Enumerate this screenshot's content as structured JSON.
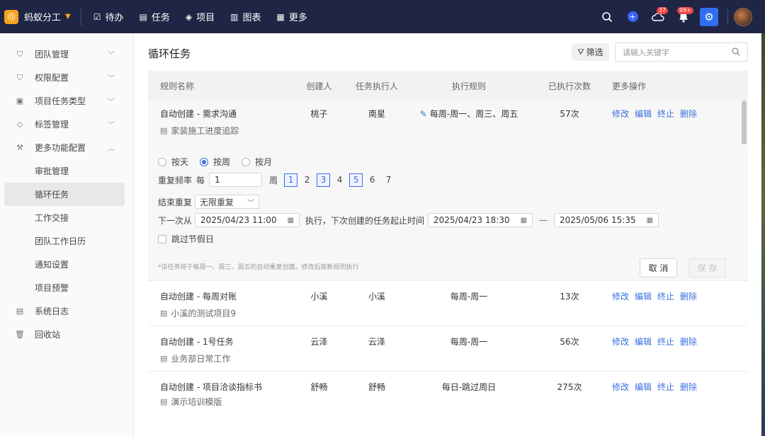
{
  "app": {
    "logo_char": "◎",
    "name": "蚂蚁分工"
  },
  "nav": [
    {
      "icon": "☑",
      "label": "待办"
    },
    {
      "icon": "▤",
      "label": "任务"
    },
    {
      "icon": "◈",
      "label": "项目"
    },
    {
      "icon": "▥",
      "label": "图表"
    },
    {
      "icon": "▦",
      "label": "更多"
    }
  ],
  "topbar": {
    "cloud_badge": "37",
    "bell_badge": "99+"
  },
  "sidebar": {
    "items": [
      {
        "label": "团队管理"
      },
      {
        "label": "权限配置"
      },
      {
        "label": "项目任务类型"
      },
      {
        "label": "标签管理"
      },
      {
        "label": "更多功能配置"
      }
    ],
    "sub_items": [
      {
        "label": "审批管理"
      },
      {
        "label": "循环任务"
      },
      {
        "label": "工作交接"
      },
      {
        "label": "团队工作日历"
      },
      {
        "label": "通知设置"
      },
      {
        "label": "项目预警"
      }
    ],
    "bottom_items": [
      {
        "label": "系统日志"
      },
      {
        "label": "回收站"
      }
    ]
  },
  "page": {
    "title": "循环任务",
    "filter_label": "筛选",
    "search_placeholder": "请输入关键字"
  },
  "table": {
    "headers": [
      "规则名称",
      "创建人",
      "任务执行人",
      "执行规则",
      "已执行次数",
      "更多操作"
    ],
    "ops": [
      "修改",
      "编辑",
      "终止",
      "删除"
    ],
    "expanded_row": {
      "name": "自动创建 - 需求沟通",
      "project": "家装施工进度追踪",
      "creator": "桃子",
      "executor": "南星",
      "rule": "每周-周一、周三、周五",
      "count": "57次"
    },
    "rows": [
      {
        "name": "自动创建 - 每周对账",
        "project": "小溪的测试项目9",
        "creator": "小溪",
        "executor": "小溪",
        "rule": "每周-周一",
        "count": "13次"
      },
      {
        "name": "自动创建 - 1号任务",
        "project": "业务部日常工作",
        "creator": "云泽",
        "executor": "云泽",
        "rule": "每周-周一",
        "count": "56次"
      },
      {
        "name": "自动创建 - 项目洽谈指标书",
        "project": "演示培训模版",
        "creator": "舒畅",
        "executor": "舒畅",
        "rule": "每日-跳过周日",
        "count": "275次"
      }
    ]
  },
  "panel": {
    "radios": [
      "按天",
      "按周",
      "按月"
    ],
    "selected_radio": "按周",
    "freq_label": "重复频率",
    "freq_prefix": "每",
    "freq_value": "1",
    "freq_unit": "周",
    "days": [
      "1",
      "2",
      "3",
      "4",
      "5",
      "6",
      "7"
    ],
    "selected_days": [
      "1",
      "3",
      "5"
    ],
    "end_label": "结束重复",
    "end_value": "无限重复",
    "next_label": "下一次从",
    "next_value": "2025/04/23 11:00",
    "exec_text": "执行，下次创建的任务起止时间",
    "start_value": "2025/04/23 18:30",
    "dash": "—",
    "end_time_value": "2025/05/06 15:35",
    "skip_label": "跳过节假日",
    "note": "*该任务将于每周一、周三、周五的自动重复创建。修改后按新规则执行",
    "cancel": "取 消",
    "save": "保 存"
  }
}
